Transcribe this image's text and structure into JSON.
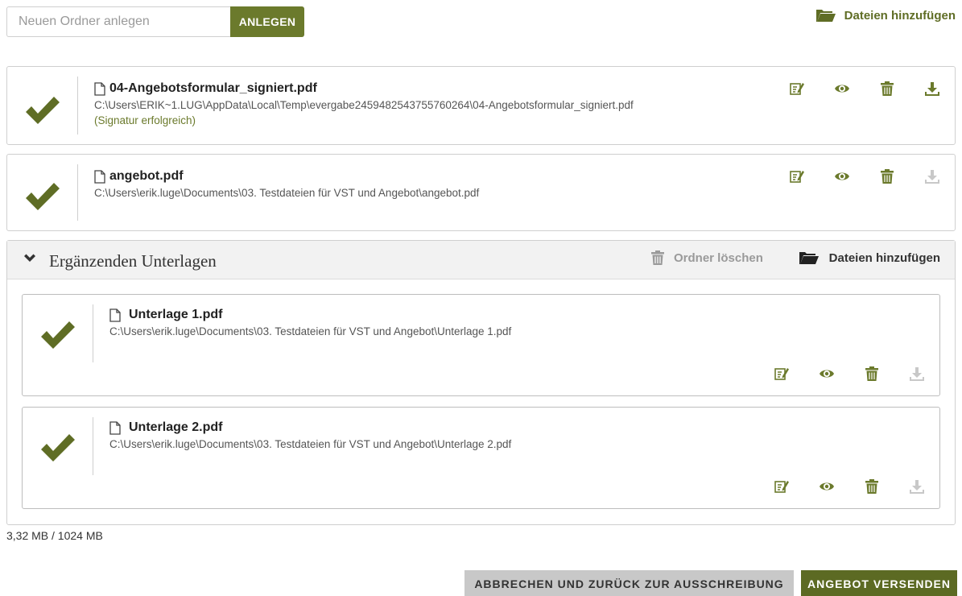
{
  "colors": {
    "accent": "#6b7a2c",
    "accent_dark": "#5c6a23",
    "muted_icon": "#c8c8c8",
    "border": "#cfcfcf"
  },
  "new_folder": {
    "placeholder": "Neuen Ordner anlegen",
    "value": "",
    "button_label": "ANLEGEN"
  },
  "add_files_top": {
    "label": "Dateien hinzufügen",
    "icon": "folder-open-icon"
  },
  "files": [
    {
      "name": "04-Angebotsformular_signiert.pdf",
      "path": "C:\\Users\\ERIK~1.LUG\\AppData\\Local\\Temp\\evergabe2459482543755760264\\04-Angebotsformular_signiert.pdf",
      "status": "(Signatur erfolgreich)",
      "download_enabled": true
    },
    {
      "name": "angebot.pdf",
      "path": "C:\\Users\\erik.luge\\Documents\\03. Testdateien für VST und Angebot\\angebot.pdf",
      "status": "",
      "download_enabled": false
    }
  ],
  "section": {
    "title": "Ergänzenden Unterlagen",
    "delete_label": "Ordner löschen",
    "add_files_label": "Dateien hinzufügen",
    "expanded": true,
    "files": [
      {
        "name": "Unterlage 1.pdf",
        "path": "C:\\Users\\erik.luge\\Documents\\03. Testdateien für VST und Angebot\\Unterlage 1.pdf",
        "download_enabled": false
      },
      {
        "name": "Unterlage 2.pdf",
        "path": "C:\\Users\\erik.luge\\Documents\\03. Testdateien für VST und Angebot\\Unterlage 2.pdf",
        "download_enabled": false
      }
    ]
  },
  "storage": "3,32 MB / 1024 MB",
  "footer": {
    "cancel_label": "ABBRECHEN UND ZURÜCK ZUR AUSSCHREIBUNG",
    "send_label": "ANGEBOT VERSENDEN"
  }
}
